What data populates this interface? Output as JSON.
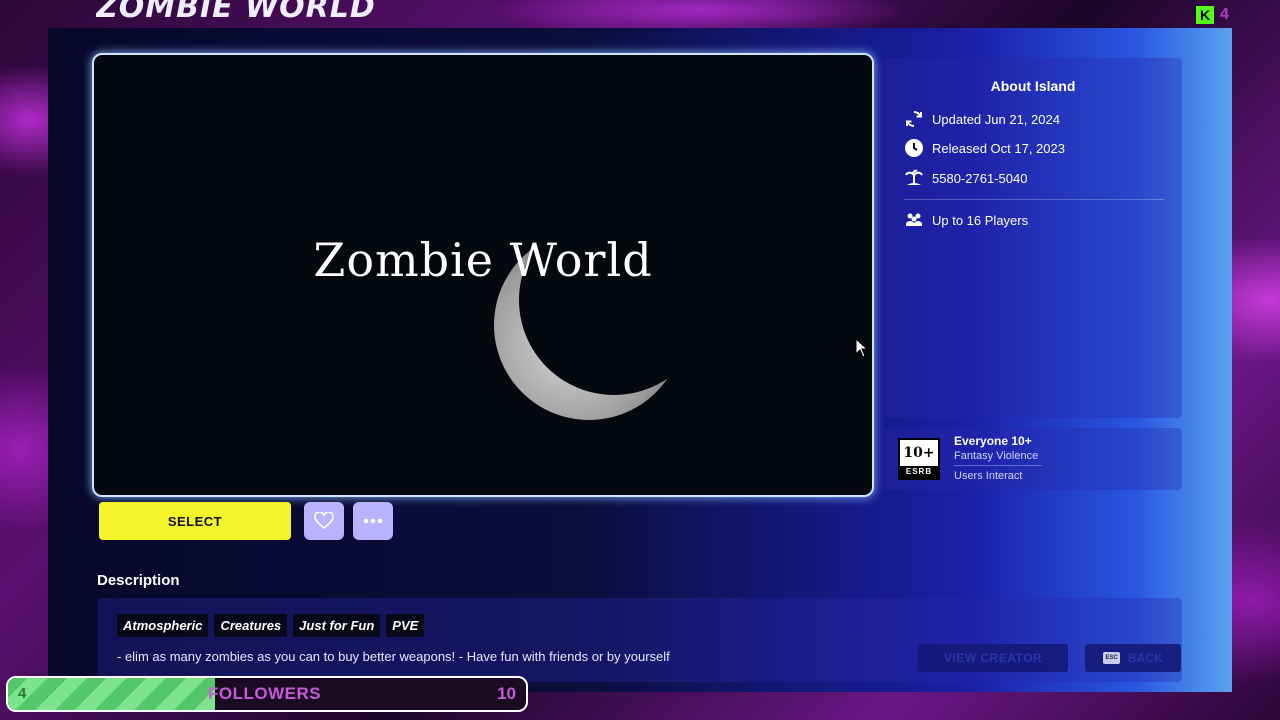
{
  "panel": {
    "title": "ZOMBIE WORLD"
  },
  "hero": {
    "title": "Zombie World"
  },
  "about": {
    "heading": "About Island",
    "updated": "Updated Jun 21, 2024",
    "released": "Released Oct 17, 2023",
    "island_code": "5580-2761-5040",
    "players": "Up to 16 Players"
  },
  "rating": {
    "badge_top": "10+",
    "badge_bottom": "ESRB",
    "title": "Everyone 10+",
    "descriptor": "Fantasy Violence",
    "interactive": "Users Interact"
  },
  "actions": {
    "select_label": "SELECT"
  },
  "description": {
    "label": "Description",
    "tags": [
      "Atmospheric",
      "Creatures",
      "Just for Fun",
      "PVE"
    ],
    "text": "- elim as many zombies as you can to buy better weapons! - Have fun with friends or by yourself",
    "view_creator": "VIEW CREATOR",
    "esc": "ESC",
    "back": "BACK"
  },
  "followers": {
    "current": "4",
    "label": "FOLLOWERS",
    "goal": "10",
    "progress_fraction": 0.4
  },
  "overlay": {
    "kick_letter": "K",
    "viewers": "4"
  },
  "colors": {
    "select": "#f3f52a",
    "secondary_button": "#b9b3ff",
    "progress": "#53c769",
    "accent": "#c75bd8"
  }
}
